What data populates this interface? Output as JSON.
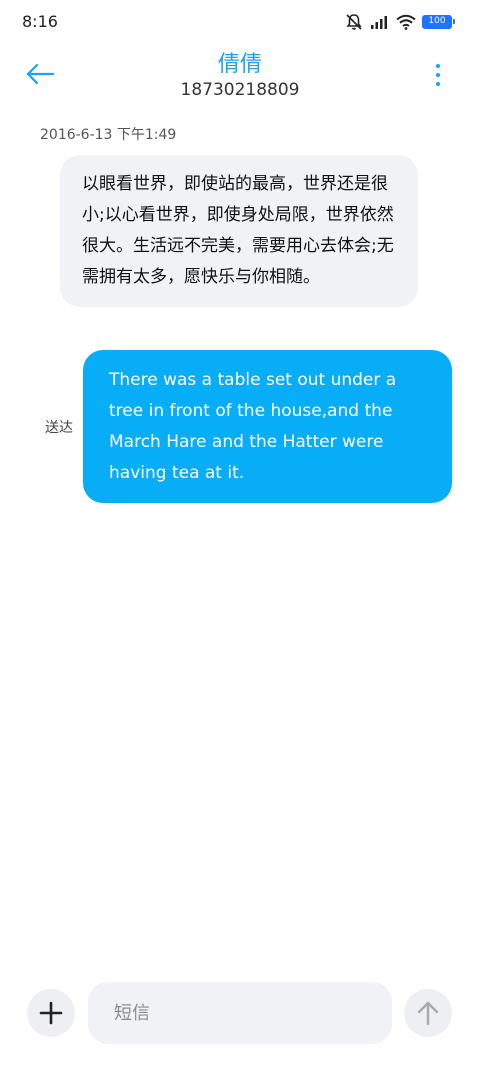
{
  "status_bar": {
    "time": "8:16",
    "battery_level": "100",
    "icons": [
      "mute-icon",
      "signal-icon",
      "wifi-icon",
      "battery-icon"
    ]
  },
  "header": {
    "title": "倩倩",
    "subtitle": "18730218809",
    "icons": [
      "back-arrow-icon",
      "more-vertical-icon"
    ]
  },
  "conversation": {
    "timestamp": "2016-6-13 下午1:49",
    "received_message": "以眼看世界，即使站的最高，世界还是很小;以心看世界，即使身处局限，世界依然很大。生活远不完美，需要用心去体会;无需拥有太多，愿快乐与你相随。",
    "sent_message": "There was a table set out under a tree in front of the house,and the March Hare and the Hatter were having tea at it.",
    "sent_status": "送达"
  },
  "composer": {
    "placeholder": "短信",
    "value": "",
    "icons": [
      "plus-icon",
      "send-arrow-icon"
    ]
  },
  "colors": {
    "accent": "#1aa3f0",
    "sent_bubble": "#08adf7",
    "received_bubble": "#f1f2f5",
    "button_bg": "#eeeff2"
  }
}
